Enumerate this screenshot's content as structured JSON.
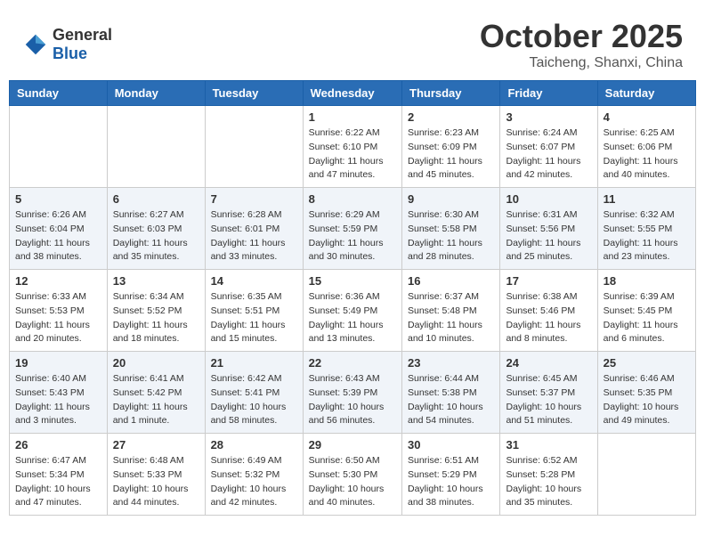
{
  "header": {
    "logo_general": "General",
    "logo_blue": "Blue",
    "month_title": "October 2025",
    "location": "Taicheng, Shanxi, China"
  },
  "weekdays": [
    "Sunday",
    "Monday",
    "Tuesday",
    "Wednesday",
    "Thursday",
    "Friday",
    "Saturday"
  ],
  "weeks": [
    [
      {
        "day": "",
        "info": ""
      },
      {
        "day": "",
        "info": ""
      },
      {
        "day": "",
        "info": ""
      },
      {
        "day": "1",
        "info": "Sunrise: 6:22 AM\nSunset: 6:10 PM\nDaylight: 11 hours and 47 minutes."
      },
      {
        "day": "2",
        "info": "Sunrise: 6:23 AM\nSunset: 6:09 PM\nDaylight: 11 hours and 45 minutes."
      },
      {
        "day": "3",
        "info": "Sunrise: 6:24 AM\nSunset: 6:07 PM\nDaylight: 11 hours and 42 minutes."
      },
      {
        "day": "4",
        "info": "Sunrise: 6:25 AM\nSunset: 6:06 PM\nDaylight: 11 hours and 40 minutes."
      }
    ],
    [
      {
        "day": "5",
        "info": "Sunrise: 6:26 AM\nSunset: 6:04 PM\nDaylight: 11 hours and 38 minutes."
      },
      {
        "day": "6",
        "info": "Sunrise: 6:27 AM\nSunset: 6:03 PM\nDaylight: 11 hours and 35 minutes."
      },
      {
        "day": "7",
        "info": "Sunrise: 6:28 AM\nSunset: 6:01 PM\nDaylight: 11 hours and 33 minutes."
      },
      {
        "day": "8",
        "info": "Sunrise: 6:29 AM\nSunset: 5:59 PM\nDaylight: 11 hours and 30 minutes."
      },
      {
        "day": "9",
        "info": "Sunrise: 6:30 AM\nSunset: 5:58 PM\nDaylight: 11 hours and 28 minutes."
      },
      {
        "day": "10",
        "info": "Sunrise: 6:31 AM\nSunset: 5:56 PM\nDaylight: 11 hours and 25 minutes."
      },
      {
        "day": "11",
        "info": "Sunrise: 6:32 AM\nSunset: 5:55 PM\nDaylight: 11 hours and 23 minutes."
      }
    ],
    [
      {
        "day": "12",
        "info": "Sunrise: 6:33 AM\nSunset: 5:53 PM\nDaylight: 11 hours and 20 minutes."
      },
      {
        "day": "13",
        "info": "Sunrise: 6:34 AM\nSunset: 5:52 PM\nDaylight: 11 hours and 18 minutes."
      },
      {
        "day": "14",
        "info": "Sunrise: 6:35 AM\nSunset: 5:51 PM\nDaylight: 11 hours and 15 minutes."
      },
      {
        "day": "15",
        "info": "Sunrise: 6:36 AM\nSunset: 5:49 PM\nDaylight: 11 hours and 13 minutes."
      },
      {
        "day": "16",
        "info": "Sunrise: 6:37 AM\nSunset: 5:48 PM\nDaylight: 11 hours and 10 minutes."
      },
      {
        "day": "17",
        "info": "Sunrise: 6:38 AM\nSunset: 5:46 PM\nDaylight: 11 hours and 8 minutes."
      },
      {
        "day": "18",
        "info": "Sunrise: 6:39 AM\nSunset: 5:45 PM\nDaylight: 11 hours and 6 minutes."
      }
    ],
    [
      {
        "day": "19",
        "info": "Sunrise: 6:40 AM\nSunset: 5:43 PM\nDaylight: 11 hours and 3 minutes."
      },
      {
        "day": "20",
        "info": "Sunrise: 6:41 AM\nSunset: 5:42 PM\nDaylight: 11 hours and 1 minute."
      },
      {
        "day": "21",
        "info": "Sunrise: 6:42 AM\nSunset: 5:41 PM\nDaylight: 10 hours and 58 minutes."
      },
      {
        "day": "22",
        "info": "Sunrise: 6:43 AM\nSunset: 5:39 PM\nDaylight: 10 hours and 56 minutes."
      },
      {
        "day": "23",
        "info": "Sunrise: 6:44 AM\nSunset: 5:38 PM\nDaylight: 10 hours and 54 minutes."
      },
      {
        "day": "24",
        "info": "Sunrise: 6:45 AM\nSunset: 5:37 PM\nDaylight: 10 hours and 51 minutes."
      },
      {
        "day": "25",
        "info": "Sunrise: 6:46 AM\nSunset: 5:35 PM\nDaylight: 10 hours and 49 minutes."
      }
    ],
    [
      {
        "day": "26",
        "info": "Sunrise: 6:47 AM\nSunset: 5:34 PM\nDaylight: 10 hours and 47 minutes."
      },
      {
        "day": "27",
        "info": "Sunrise: 6:48 AM\nSunset: 5:33 PM\nDaylight: 10 hours and 44 minutes."
      },
      {
        "day": "28",
        "info": "Sunrise: 6:49 AM\nSunset: 5:32 PM\nDaylight: 10 hours and 42 minutes."
      },
      {
        "day": "29",
        "info": "Sunrise: 6:50 AM\nSunset: 5:30 PM\nDaylight: 10 hours and 40 minutes."
      },
      {
        "day": "30",
        "info": "Sunrise: 6:51 AM\nSunset: 5:29 PM\nDaylight: 10 hours and 38 minutes."
      },
      {
        "day": "31",
        "info": "Sunrise: 6:52 AM\nSunset: 5:28 PM\nDaylight: 10 hours and 35 minutes."
      },
      {
        "day": "",
        "info": ""
      }
    ]
  ]
}
